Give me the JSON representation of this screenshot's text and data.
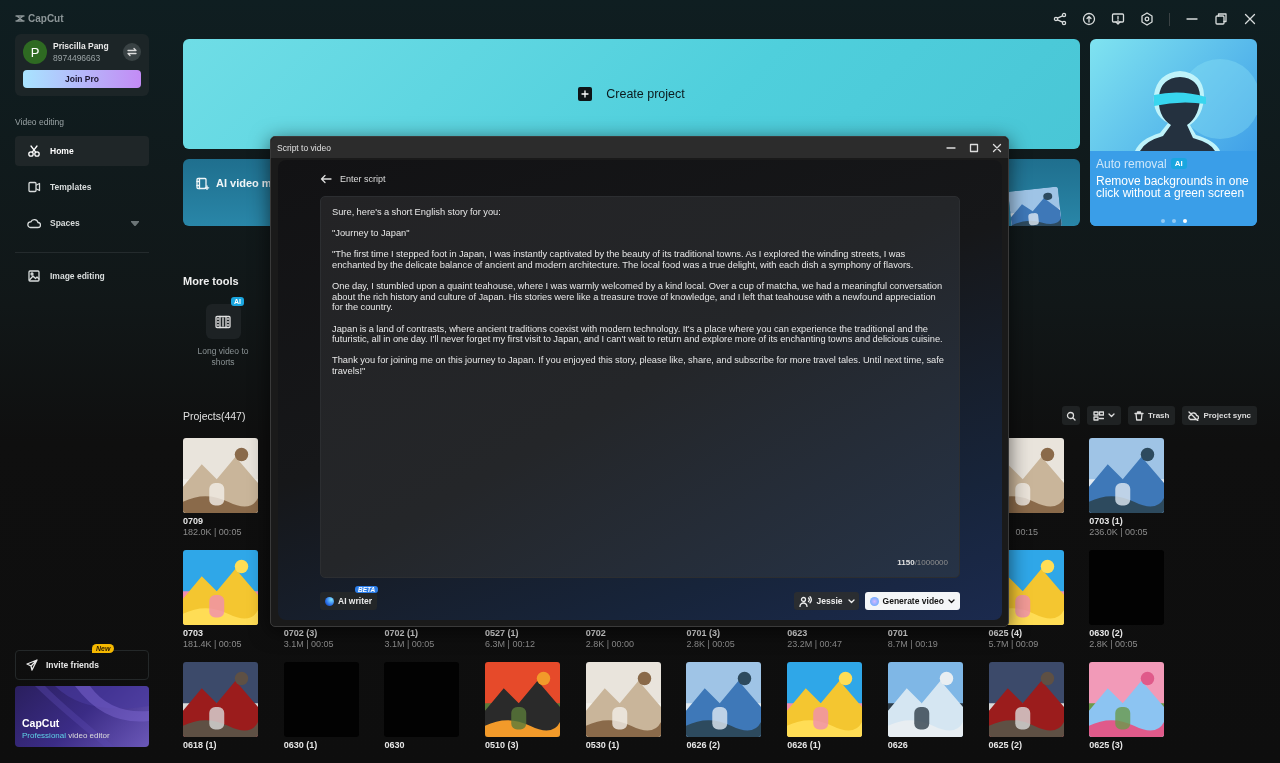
{
  "app": {
    "logo": "CapCut"
  },
  "profile": {
    "avatar": "P",
    "name": "Priscilla Pang",
    "id": "8974496663",
    "upgrade": "Join Pro"
  },
  "sidebar": {
    "section": "Video editing",
    "items": [
      {
        "label": "Home",
        "selected": true,
        "expandable": false
      },
      {
        "label": "Templates",
        "selected": false,
        "expandable": false
      },
      {
        "label": "Spaces",
        "selected": false,
        "expandable": true
      }
    ],
    "extra_items": [
      {
        "label": "Image editing",
        "selected": false
      }
    ],
    "invite": {
      "label": "Invite friends",
      "badge": "New"
    },
    "promo": {
      "title": "CapCut",
      "tagline": [
        "Professional",
        "video editor"
      ]
    }
  },
  "banners": {
    "create": "Create project",
    "ai_video": "AI video m",
    "feature": {
      "title": "Auto removal",
      "badge": "AI",
      "text": "Remove backgrounds in one click without a green screen",
      "dots": [
        {
          "selected": false
        },
        {
          "selected": false
        },
        {
          "selected": true
        }
      ]
    }
  },
  "more_tools": {
    "title": "More tools",
    "tools": [
      {
        "label": "Long video to shorts",
        "badge": "AI"
      }
    ]
  },
  "projects": {
    "title": "Projects(447)",
    "toolbar": [
      "Trash",
      "Project sync"
    ],
    "rows": [
      [
        {
          "name": "0709",
          "meta": "182.0K | 00:05",
          "kind": "picture"
        },
        null,
        null,
        null,
        null,
        null,
        null,
        null,
        {
          "meta": "00:15",
          "kind": "picture"
        },
        {
          "name": "0703 (1)",
          "meta": "236.0K | 00:05",
          "kind": "picture"
        }
      ],
      [
        {
          "name": "0703",
          "meta": "181.4K | 00:05",
          "kind": "picture"
        },
        {
          "name": "0702 (3)",
          "meta": "3.1M | 00:05"
        },
        {
          "name": "0702 (1)",
          "meta": "3.1M | 00:05"
        },
        {
          "name": "0527 (1)",
          "meta": "6.3M | 00:12"
        },
        {
          "name": "0702",
          "meta": "2.8K | 00:00"
        },
        {
          "name": "0701 (3)",
          "meta": "2.8K | 00:05"
        },
        {
          "name": "0623",
          "meta": "23.2M | 00:47"
        },
        {
          "name": "0701",
          "meta": "8.7M | 00:19"
        },
        {
          "name": "0625 (4)",
          "meta": "5.7M | 00:09",
          "kind": "picture"
        },
        {
          "name": "0630 (2)",
          "meta": "2.8K | 00:05",
          "kind": "black"
        }
      ],
      [
        {
          "name": "0618 (1)",
          "kind": "picture"
        },
        {
          "name": "0630 (1)",
          "kind": "black"
        },
        {
          "name": "0630",
          "kind": "black"
        },
        {
          "name": "0510 (3)",
          "kind": "picture"
        },
        {
          "name": "0530 (1)",
          "kind": "picture"
        },
        {
          "name": "0626 (2)",
          "kind": "picture"
        },
        {
          "name": "0626 (1)",
          "kind": "picture"
        },
        {
          "name": "0626",
          "kind": "picture"
        },
        {
          "name": "0625 (2)",
          "kind": "picture"
        },
        {
          "name": "0625 (3)",
          "kind": "picture"
        }
      ]
    ]
  },
  "dialog": {
    "title": "Script to video",
    "heading": "Enter script",
    "script": "Sure, here's a short English story for you:\n\n\"Journey to Japan\"\n\n\"The first time I stepped foot in Japan, I was instantly captivated by the beauty of its traditional towns. As I explored the winding streets, I was enchanted by the delicate balance of ancient and modern architecture. The local food was a true delight, with each dish a symphony of flavors.\n\nOne day, I stumbled upon a quaint teahouse, where I was warmly welcomed by a kind local. Over a cup of matcha, we had a meaningful conversation about the rich history and culture of Japan. His stories were like a treasure trove of knowledge, and I left that teahouse with a newfound appreciation for the country.\n\nJapan is a land of contrasts, where ancient traditions coexist with modern technology. It's a place where you can experience the traditional and the futuristic, all in one day. I'll never forget my first visit to Japan, and I can't wait to return and explore more of its enchanting towns and delicious cuisine.\n\nThank you for joining me on this journey to Japan. If you enjoyed this story, please like, share, and subscribe for more travel tales. Until next time, safe travels!\"",
    "count": "1150",
    "limit": "/1000000",
    "writer": {
      "label": "AI writer",
      "badge": "BETA"
    },
    "voice": "Jessie",
    "generate": "Generate video"
  }
}
